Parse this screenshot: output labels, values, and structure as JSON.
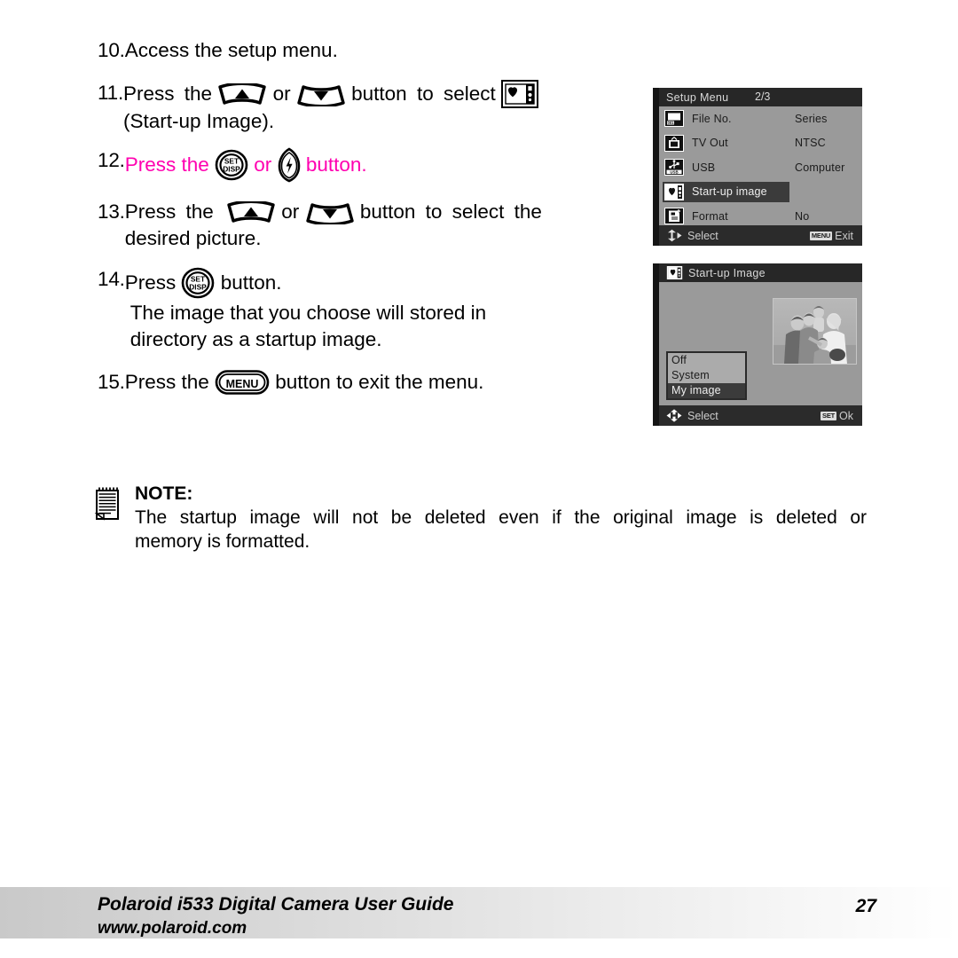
{
  "document": {
    "steps": [
      {
        "num": "10.",
        "text": "Access the setup menu."
      },
      {
        "num": "11.",
        "prefix": "Press  the",
        "mid": "or",
        "suffix": "button  to  select",
        "line2": "(Start-up Image)."
      },
      {
        "num": "12.",
        "prefix": "Press the",
        "mid": "or",
        "suffix": "button."
      },
      {
        "num": "13.",
        "prefix": "Press  the",
        "mid": "or",
        "suffix": "button  to  select  the",
        "line2": "desired picture."
      },
      {
        "num": "14.",
        "prefix": "Press",
        "suffix": "button.",
        "line2": "The   image   that   you   choose   will   stored   in",
        "line3": "directory as a startup image."
      },
      {
        "num": "15.",
        "prefix": "Press the",
        "suffix": "button to exit the menu."
      }
    ],
    "note": {
      "title": "NOTE:",
      "line1": "The  startup  image  will  not  be  deleted  even  if  the  original  image  is  deleted  or",
      "line2": "memory is formatted."
    }
  },
  "lcd_setup": {
    "title": "Setup Menu",
    "page": "2/3",
    "rows": [
      {
        "icon": "file-number-icon",
        "label": "File No.",
        "value": "Series",
        "selected": false
      },
      {
        "icon": "tv-out-icon",
        "label": "TV Out",
        "value": "NTSC",
        "selected": false
      },
      {
        "icon": "usb-icon",
        "label": "USB",
        "value": "Computer",
        "selected": false
      },
      {
        "icon": "startup-image-icon",
        "label": "Start-up image",
        "value": "",
        "selected": true
      },
      {
        "icon": "format-icon",
        "label": "Format",
        "value": "No",
        "selected": false
      }
    ],
    "status": {
      "left": "Select",
      "right_key": "MENU",
      "right": "Exit"
    }
  },
  "lcd_startup": {
    "title": "Start-up Image",
    "options": [
      {
        "label": "Off",
        "selected": false
      },
      {
        "label": "System",
        "selected": false
      },
      {
        "label": "My image",
        "selected": true
      }
    ],
    "status": {
      "left": "Select",
      "right_key": "SET",
      "right": "Ok"
    }
  },
  "footer": {
    "title": "Polaroid i533 Digital Camera User Guide",
    "url": "www.polaroid.com",
    "page": "27"
  },
  "colors": {
    "highlight_text": "#ff00b0",
    "lcd_background": "#9a9a9a",
    "lcd_chrome": "#2b2b2b",
    "selection": "#3b3b3b"
  }
}
